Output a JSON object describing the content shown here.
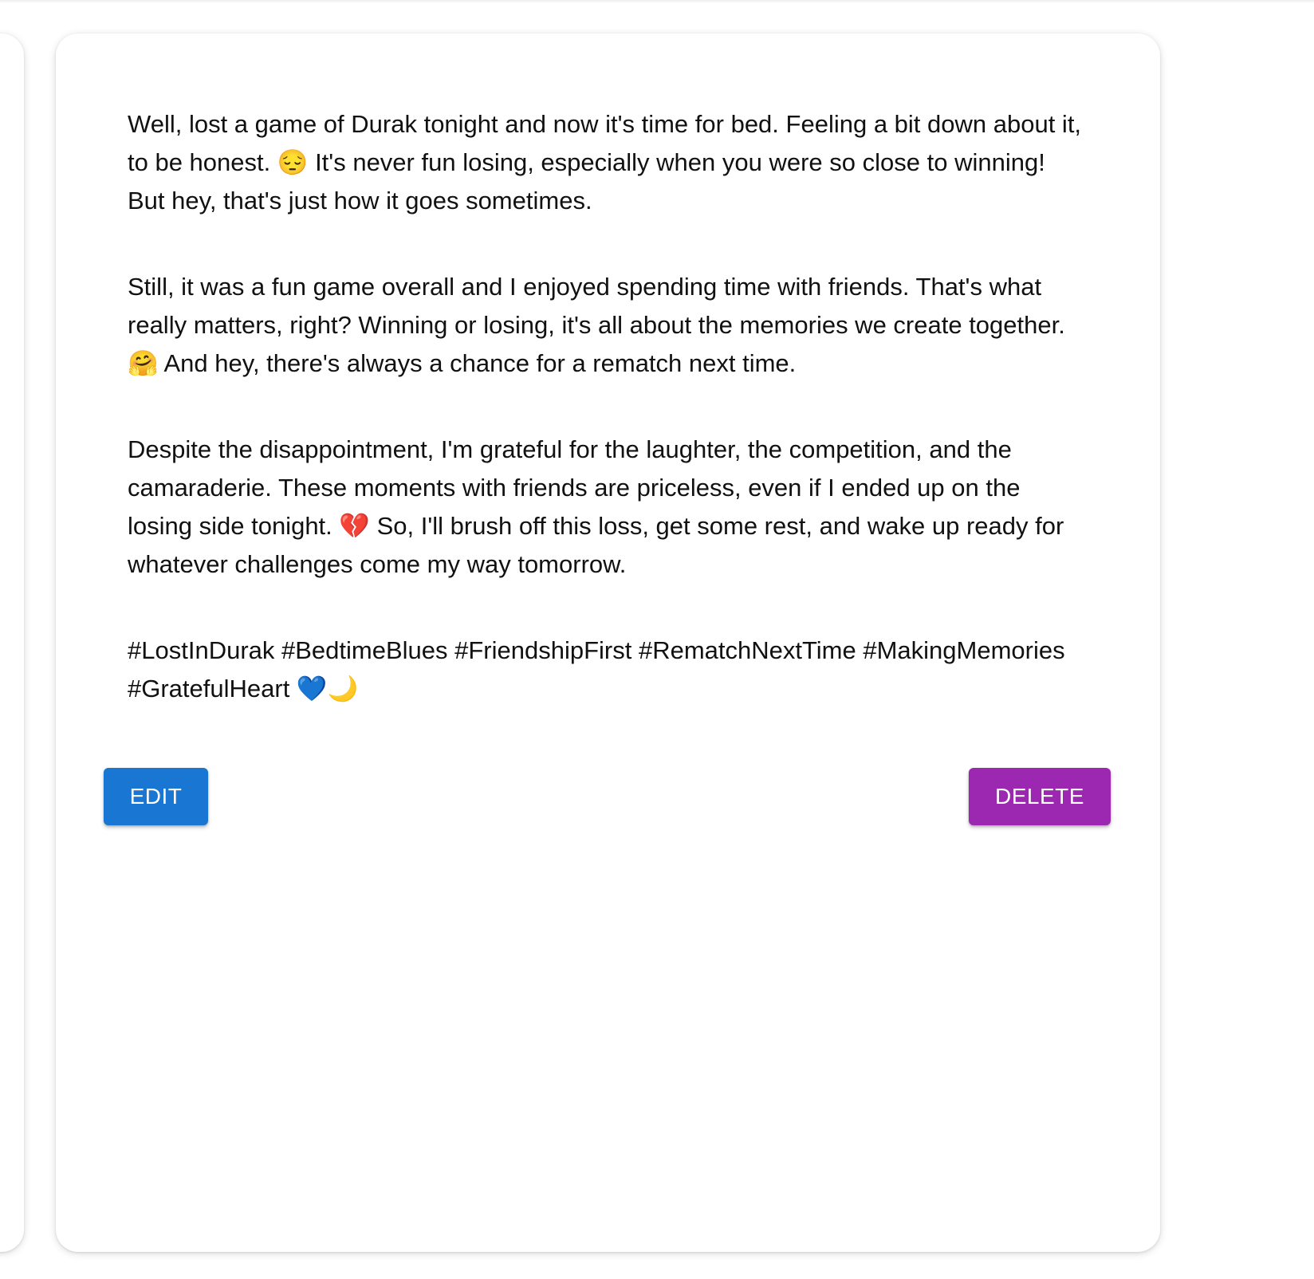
{
  "post": {
    "paragraphs": [
      "Well, lost a game of Durak tonight and now it's time for bed. Feeling a bit down about it, to be honest. 😔 It's never fun losing, especially when you were so close to winning! But hey, that's just how it goes sometimes.",
      "Still, it was a fun game overall and I enjoyed spending time with friends. That's what really matters, right? Winning or losing, it's all about the memories we create together. 🤗 And hey, there's always a chance for a rematch next time.",
      "Despite the disappointment, I'm grateful for the laughter, the competition, and the camaraderie. These moments with friends are priceless, even if I ended up on the losing side tonight. 💔 So, I'll brush off this loss, get some rest, and wake up ready for whatever challenges come my way tomorrow."
    ],
    "hashtags": "#LostInDurak #BedtimeBlues #FriendshipFirst #RematchNextTime #MakingMemories #GratefulHeart 💙🌙"
  },
  "actions": {
    "edit_label": "EDIT",
    "delete_label": "DELETE"
  },
  "colors": {
    "edit_button": "#1976d2",
    "delete_button": "#9c27b0",
    "text": "#111111",
    "card_background": "#ffffff"
  }
}
